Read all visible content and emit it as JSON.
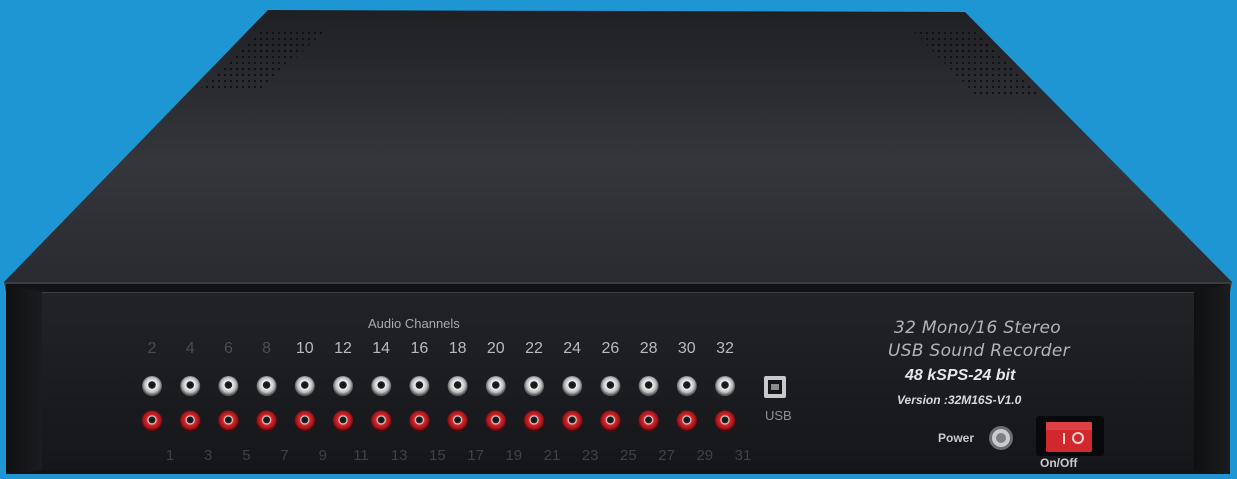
{
  "panel": {
    "audio_channels_title": "Audio Channels",
    "even_channels": [
      "2",
      "4",
      "6",
      "8",
      "10",
      "12",
      "14",
      "16",
      "18",
      "20",
      "22",
      "24",
      "26",
      "28",
      "30",
      "32"
    ],
    "odd_channels": [
      "1",
      "3",
      "5",
      "7",
      "9",
      "11",
      "13",
      "15",
      "17",
      "19",
      "21",
      "23",
      "25",
      "27",
      "29",
      "31"
    ],
    "usb_label": "USB",
    "model_line1": "32 Mono/16 Stereo",
    "model_line2": "USB Sound Recorder",
    "spec_line": "48 kSPS-24 bit",
    "version_line": "Version :32M16S-V1.0",
    "power_label": "Power",
    "switch_label": "On/Off"
  },
  "colors": {
    "background": "#1e96d4",
    "chassis": "#2c2d31",
    "front_panel": "#1d1e21",
    "jack_top_ring": "#d8d9dc",
    "jack_bottom_ring": "#c81e24",
    "power_switch": "#d0282c"
  }
}
